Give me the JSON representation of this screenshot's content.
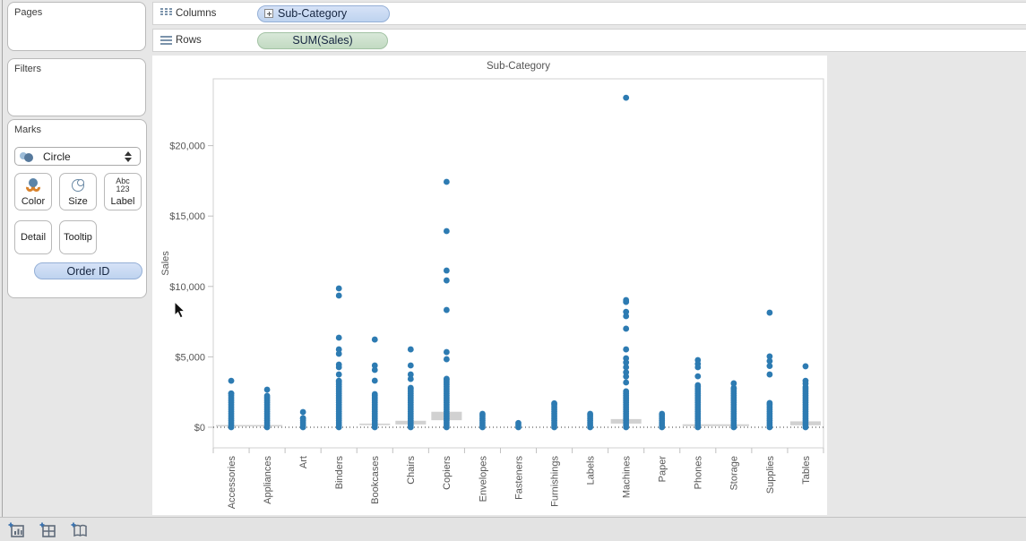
{
  "colors": {
    "bg": "#e7e7e7",
    "card-border": "#b9b9b9",
    "pill-blue": "#bed3ef",
    "pill-blue-hi": "#d6e2f7",
    "pill-blue-border": "#94afd6",
    "pill-green": "#c2dac2",
    "pill-green-border": "#a3c2a4",
    "pill-text": "#152540",
    "shelf-icon": "#7b93ab",
    "text": "#3c3c3c",
    "mark-blue": "#2d7bb2",
    "gray-mark": "#c9c9c9"
  },
  "sidebar": {
    "pages_label": "Pages",
    "filters_label": "Filters",
    "marks": {
      "label": "Marks",
      "mark_type": "Circle",
      "color_button": "Color",
      "size_button": "Size",
      "label_button": "Label",
      "label_icon_line1": "Abc",
      "label_icon_line2": "123",
      "detail_button": "Detail",
      "tooltip_button": "Tooltip",
      "pill": "Order ID"
    }
  },
  "shelves": {
    "columns_label": "Columns",
    "columns_pill": "Sub-Category",
    "rows_label": "Rows",
    "rows_pill": "SUM(Sales)"
  },
  "statusbar": {
    "icons": [
      "new-worksheet",
      "new-dashboard",
      "new-story"
    ]
  },
  "chart_data": {
    "type": "scatter",
    "title": "Sub-Category",
    "ylabel": "Sales",
    "yticks": [
      0,
      5000,
      10000,
      15000,
      20000
    ],
    "ytick_labels": [
      "$0",
      "$5,000",
      "$10,000",
      "$15,000",
      "$20,000"
    ],
    "ylim": [
      -1460,
      24750
    ],
    "grid": false,
    "zero_line": true,
    "cluster_step": 160,
    "categories": [
      "Accessories",
      "Appliances",
      "Art",
      "Binders",
      "Bookcases",
      "Chairs",
      "Copiers",
      "Envelopes",
      "Fasteners",
      "Furnishings",
      "Labels",
      "Machines",
      "Paper",
      "Phones",
      "Storage",
      "Supplies",
      "Tables"
    ],
    "series": [
      {
        "category": "Accessories",
        "points_above": [
          3300
        ],
        "cluster_top": 2400
      },
      {
        "category": "Appliances",
        "points_above": [
          2670
        ],
        "cluster_top": 2230
      },
      {
        "category": "Art",
        "points_above": [
          1080
        ],
        "cluster_top": 640
      },
      {
        "category": "Binders",
        "points_above": [
          9860,
          9350,
          6360,
          5530,
          5220,
          4450,
          4260,
          3750
        ],
        "cluster_top": 3300
      },
      {
        "category": "Bookcases",
        "points_above": [
          6230,
          4390,
          4070,
          3310
        ],
        "cluster_top": 2350
      },
      {
        "category": "Chairs",
        "points_above": [
          5530,
          4390,
          3750,
          3430
        ],
        "cluster_top": 2800
      },
      {
        "category": "Copiers",
        "points_above": [
          17430,
          13930,
          11130,
          10430,
          8330,
          5340,
          4830
        ],
        "cluster_top": 3440
      },
      {
        "category": "Envelopes",
        "points_above": [],
        "cluster_top": 950
      },
      {
        "category": "Fasteners",
        "points_above": [],
        "cluster_top": 300
      },
      {
        "category": "Furnishings",
        "points_above": [],
        "cluster_top": 1700
      },
      {
        "category": "Labels",
        "points_above": [],
        "cluster_top": 950
      },
      {
        "category": "Machines",
        "points_above": [
          23400,
          9030,
          8900,
          8200,
          7890,
          7000,
          5530,
          4900,
          4600,
          4260,
          3900,
          3600,
          3180
        ],
        "cluster_top": 2550
      },
      {
        "category": "Paper",
        "points_above": [],
        "cluster_top": 950
      },
      {
        "category": "Phones",
        "points_above": [
          4770,
          4500,
          4260,
          3620
        ],
        "cluster_top": 2990
      },
      {
        "category": "Storage",
        "points_above": [
          3120
        ],
        "cluster_top": 2800
      },
      {
        "category": "Supplies",
        "points_above": [
          8140,
          5030,
          4700,
          4350,
          3750
        ],
        "cluster_top": 1720
      },
      {
        "category": "Tables",
        "points_above": [
          4330,
          3300,
          3100
        ],
        "cluster_top": 2860
      }
    ],
    "gray_marks": [
      {
        "from": "Accessories",
        "to": "Appliances",
        "v_from": 60,
        "v_to": 160
      },
      {
        "from": "Bookcases",
        "to": "Bookcases",
        "v_from": 150,
        "v_to": 260
      },
      {
        "from": "Chairs",
        "to": "Chairs",
        "v_from": 200,
        "v_to": 460
      },
      {
        "from": "Copiers",
        "to": "Copiers",
        "v_from": 500,
        "v_to": 1100
      },
      {
        "from": "Machines",
        "to": "Machines",
        "v_from": 260,
        "v_to": 580
      },
      {
        "from": "Phones",
        "to": "Storage",
        "v_from": 80,
        "v_to": 210
      },
      {
        "from": "Tables",
        "to": "Tables",
        "v_from": 140,
        "v_to": 420
      }
    ]
  }
}
